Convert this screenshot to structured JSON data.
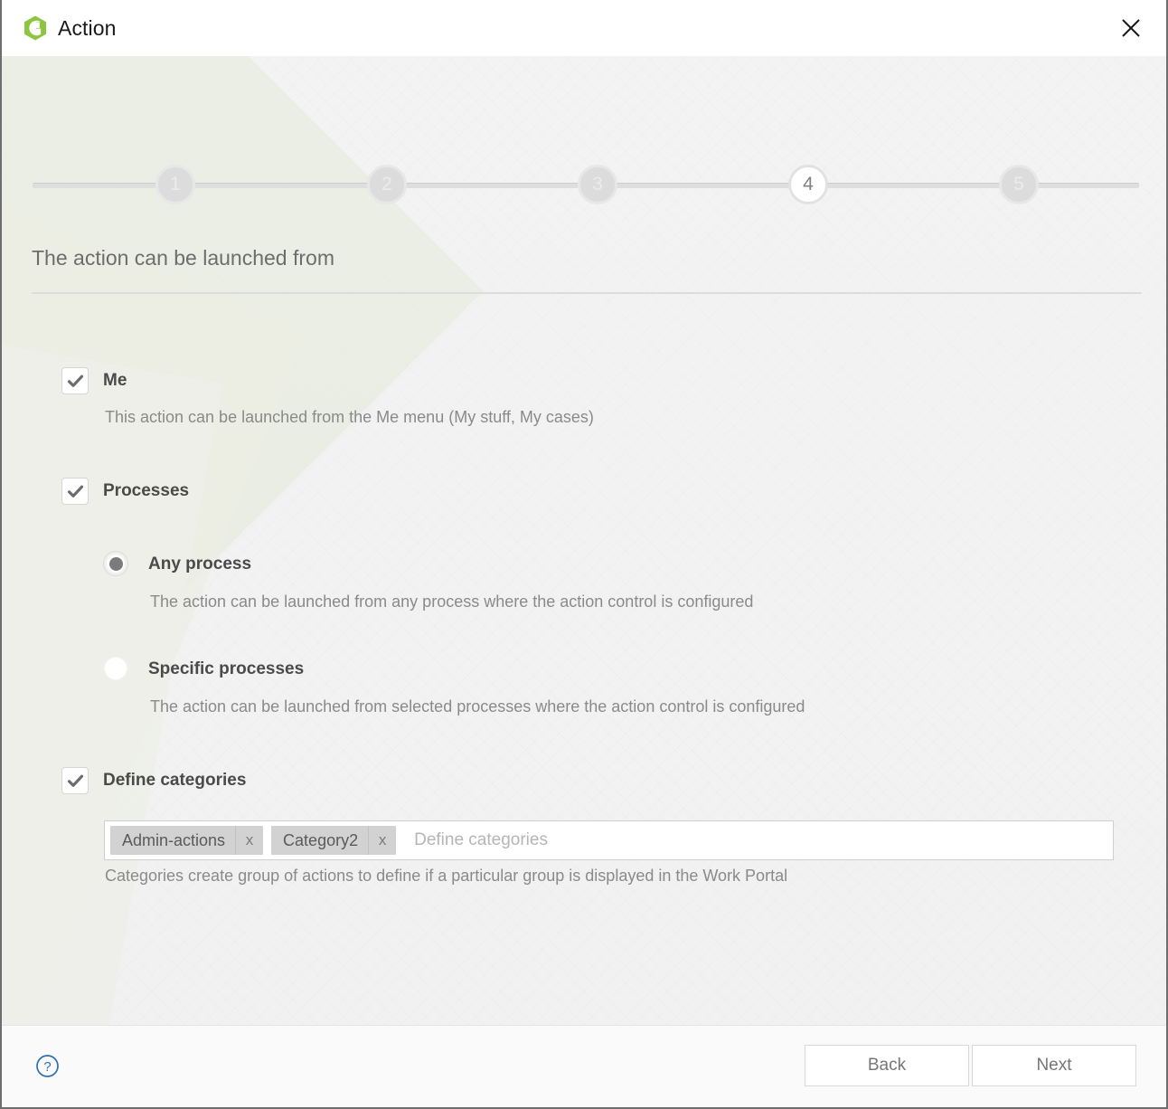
{
  "window": {
    "title": "Action",
    "logo_icon": "green-hexagon-logo",
    "close_icon": "close-icon"
  },
  "stepper": {
    "steps": [
      {
        "number": "1",
        "state": "inactive"
      },
      {
        "number": "2",
        "state": "inactive"
      },
      {
        "number": "3",
        "state": "inactive"
      },
      {
        "number": "4",
        "state": "active"
      },
      {
        "number": "5",
        "state": "inactive"
      }
    ]
  },
  "section": {
    "title": "The action can be launched from"
  },
  "options": {
    "me": {
      "label": "Me",
      "checked": true,
      "description": "This action can be launched from the Me menu (My stuff, My cases)"
    },
    "processes": {
      "label": "Processes",
      "checked": true,
      "radios": [
        {
          "label": "Any process",
          "selected": true,
          "description": "The action can be launched from any process where the action control is configured"
        },
        {
          "label": "Specific processes",
          "selected": false,
          "description": "The action can be launched from selected processes where the action control is configured"
        }
      ]
    },
    "define_categories": {
      "label": "Define categories",
      "checked": true,
      "input": {
        "placeholder": "Define categories",
        "tags": [
          {
            "label": "Admin-actions",
            "remove_icon": "x"
          },
          {
            "label": "Category2",
            "remove_icon": "x"
          }
        ]
      },
      "help_text": "Categories create group of actions to define if a particular group is displayed in the Work Portal"
    }
  },
  "footer": {
    "help_icon": "question-mark-circle-icon",
    "back_label": "Back",
    "next_label": "Next"
  },
  "colors": {
    "brand_green": "#8cc63f",
    "help_blue": "#2d6fb5",
    "tag_bg": "#d2d2d2",
    "content_bg": "#f2f2f2"
  }
}
